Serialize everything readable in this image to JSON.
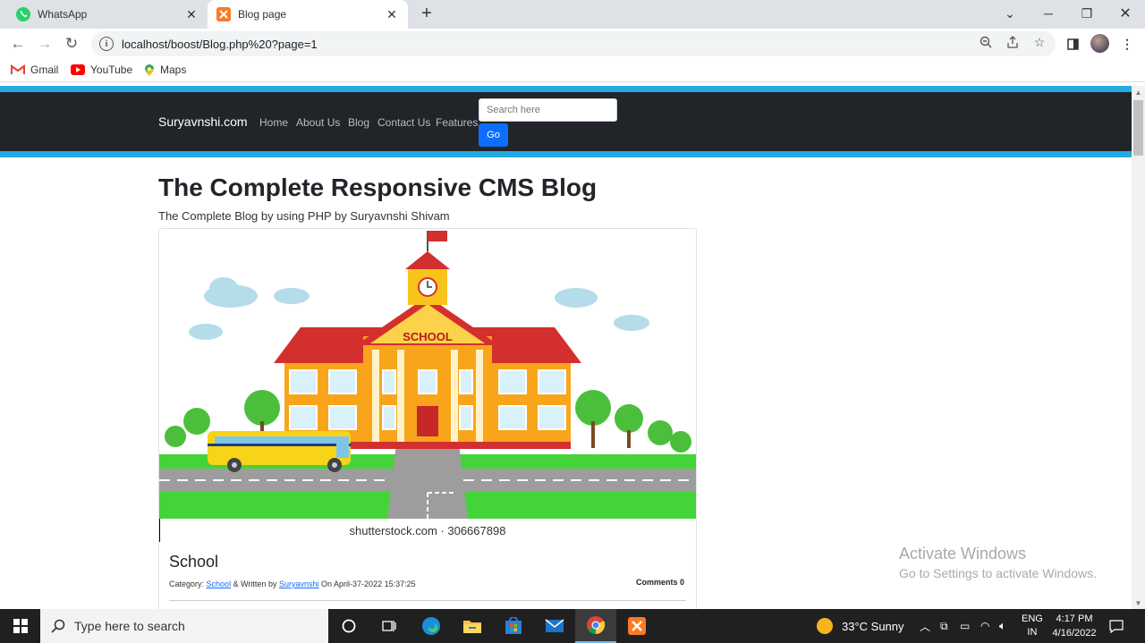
{
  "browser": {
    "tabs": [
      {
        "title": "WhatsApp",
        "active": false,
        "icon": "whatsapp-icon",
        "color": "#25d366"
      },
      {
        "title": "Blog page",
        "active": true,
        "icon": "xampp-icon",
        "color": "#fb7a24"
      }
    ],
    "new_tab_label": "+",
    "url": "localhost/boost/Blog.php%20?page=1",
    "bookmarks": [
      {
        "label": "Gmail",
        "icon": "gmail-icon"
      },
      {
        "label": "YouTube",
        "icon": "youtube-icon"
      },
      {
        "label": "Maps",
        "icon": "maps-icon"
      }
    ]
  },
  "site": {
    "brand": "Suryavnshi.com",
    "nav": [
      "Home",
      "About Us",
      "Blog",
      "Contact Us",
      "Features"
    ],
    "search_placeholder": "Search here",
    "search_button": "Go",
    "accent": "#27aae1",
    "navbar_color": "#212529"
  },
  "page": {
    "heading": "The Complete Responsive CMS Blog",
    "subheading": "The Complete Blog by using PHP by Suryavnshi Shivam"
  },
  "post": {
    "image_text": "SCHOOL",
    "image_caption": "shutterstock.com · 306667898",
    "title": "School",
    "category_label": "Category:",
    "category": "School",
    "written_label": "& Written by",
    "author": "Suryavnshi",
    "on_label": "On",
    "date": "April-37-2022 15:37:25",
    "comments": "Comments 0"
  },
  "windows": {
    "activate_title": "Activate Windows",
    "activate_sub": "Go to Settings to activate Windows.",
    "search_placeholder": "Type here to search",
    "weather": "33°C  Sunny",
    "lang_top": "ENG",
    "lang_bottom": "IN",
    "time": "4:17 PM",
    "date": "4/16/2022"
  }
}
